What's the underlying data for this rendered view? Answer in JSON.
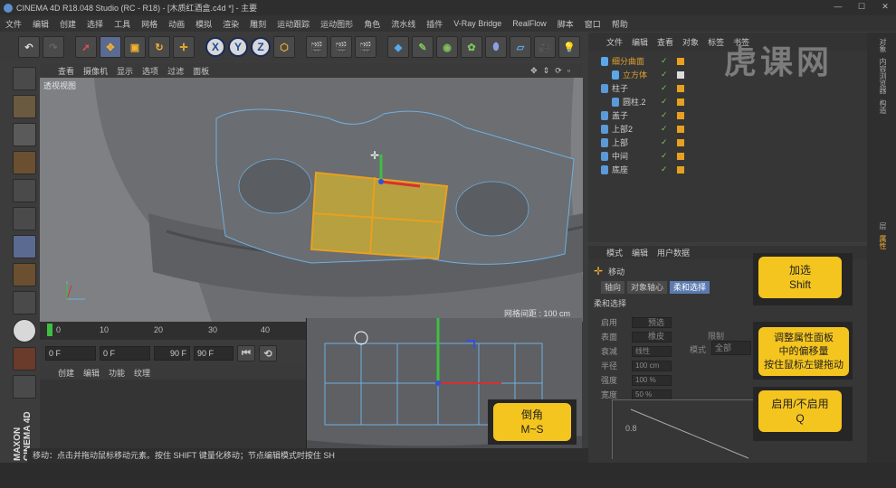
{
  "title": "CINEMA 4D R18.048 Studio (RC - R18) - [木质红酒盒.c4d *] - 主要",
  "menu": [
    "文件",
    "编辑",
    "创建",
    "选择",
    "工具",
    "网格",
    "动画",
    "模拟",
    "渲染",
    "雕刻",
    "运动跟踪",
    "运动图形",
    "角色",
    "流水线",
    "插件",
    "V-Ray Bridge",
    "RealFlow",
    "脚本",
    "窗口",
    "帮助"
  ],
  "viewport": {
    "menu": [
      "查看",
      "摄像机",
      "显示",
      "选项",
      "过滤",
      "面板"
    ],
    "label": "透视视图",
    "grid_info": "网格间距 : 100 cm"
  },
  "timeline": {
    "ticks": [
      "0",
      "10",
      "20",
      "30",
      "40"
    ]
  },
  "transport": {
    "start": "0 F",
    "current": "0 F",
    "end_inner": "90 F",
    "end": "90 F"
  },
  "material": {
    "menu": [
      "创建",
      "编辑",
      "功能",
      "纹理"
    ]
  },
  "status": "移动：点击并拖动鼠标移动元素。按住 SHIFT 键量化移动；节点编辑模式时按住 SH",
  "objects": {
    "menu": [
      "文件",
      "编辑",
      "查看",
      "对象",
      "标签",
      "书签"
    ],
    "items": [
      {
        "name": "细分曲面",
        "indent": 0,
        "color": "#e0a030"
      },
      {
        "name": "立方体",
        "indent": 1,
        "color": "#e0a030"
      },
      {
        "name": "柱子",
        "indent": 0,
        "color": "#cfcfcf"
      },
      {
        "name": "圆柱.2",
        "indent": 1,
        "color": "#cfcfcf"
      },
      {
        "name": "盖子",
        "indent": 0,
        "color": "#cfcfcf"
      },
      {
        "name": "上部2",
        "indent": 0,
        "color": "#cfcfcf"
      },
      {
        "name": "上部",
        "indent": 0,
        "color": "#cfcfcf"
      },
      {
        "name": "中间",
        "indent": 0,
        "color": "#cfcfcf"
      },
      {
        "name": "底座",
        "indent": 0,
        "color": "#cfcfcf"
      }
    ]
  },
  "attributes": {
    "menu": [
      "模式",
      "编辑",
      "用户数据"
    ],
    "tool": "移动",
    "tabs": [
      "轴向",
      "对象轴心",
      "柔和选择"
    ],
    "section": "柔和选择",
    "fields": [
      {
        "label": "启用",
        "value": ""
      },
      {
        "label": "表面",
        "value": ""
      },
      {
        "label": "衰减",
        "value": "线性"
      },
      {
        "label": "半径",
        "value": "100 cm"
      },
      {
        "label": "强度",
        "value": "100 %"
      },
      {
        "label": "宽度",
        "value": "50 %"
      }
    ],
    "extra": {
      "preview": "预选",
      "rubber": "橡皮",
      "limit": "限制",
      "mode": "模式",
      "mode_value": "全部"
    },
    "graph_label": "0.8"
  },
  "right_strip": [
    "对象",
    "内容浏览器",
    "构造",
    "层",
    "属性"
  ],
  "callouts": {
    "add_select": [
      "加选",
      "Shift"
    ],
    "adjust": [
      "调整属性面板",
      "中的偏移量",
      "按住鼠标左键拖动"
    ],
    "toggle": [
      "启用/不启用",
      "Q"
    ],
    "bevel": [
      "倒角",
      "M~S"
    ]
  },
  "watermark": "虎课网",
  "side_logo": "MAXON CINEMA 4D",
  "colors": {
    "accent": "#f4c51f",
    "selection": "#e8a020",
    "wire": "#6fb0e0"
  }
}
